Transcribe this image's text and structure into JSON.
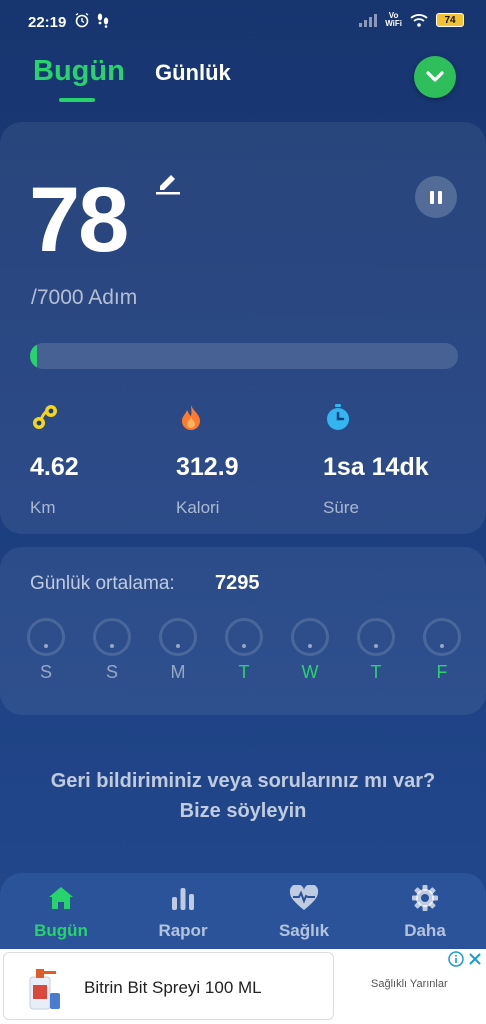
{
  "status_bar": {
    "time": "22:19",
    "network": "Vo WiFi",
    "battery": "74"
  },
  "header": {
    "tab_today": "Bugün",
    "tab_daily": "Günlük"
  },
  "main_card": {
    "steps": "78",
    "goal_text": "/7000 Adım",
    "progress_fraction": 0.011,
    "stats": [
      {
        "icon": "distance-icon",
        "value": "4.62",
        "label": "Km",
        "color": "#f3d51c"
      },
      {
        "icon": "flame-icon",
        "value": "312.9",
        "label": "Kalori",
        "color": "#ff7a2e"
      },
      {
        "icon": "stopwatch-icon",
        "value": "1sa 14dk",
        "label": "Süre",
        "color": "#33b6f0"
      }
    ]
  },
  "weekly": {
    "avg_label": "Günlük ortalama:",
    "avg_value": "7295",
    "days": [
      "S",
      "S",
      "M",
      "T",
      "W",
      "T",
      "F"
    ],
    "active_days": [
      3,
      4,
      5,
      6
    ]
  },
  "feedback": {
    "line1": "Geri bildiriminiz veya sorularınız mı var?",
    "line2": "Bize söyleyin"
  },
  "bottom_nav": {
    "items": [
      "Bugün",
      "Rapor",
      "Sağlık",
      "Daha"
    ],
    "active": 0
  },
  "ad": {
    "title": "Bitrin Bit Spreyi 100 ML",
    "advertiser": "Sağlıklı Yarınlar"
  },
  "colors": {
    "accent": "#27d36b",
    "background": "#1b3c7c",
    "nav_bg": "#2a5399"
  }
}
